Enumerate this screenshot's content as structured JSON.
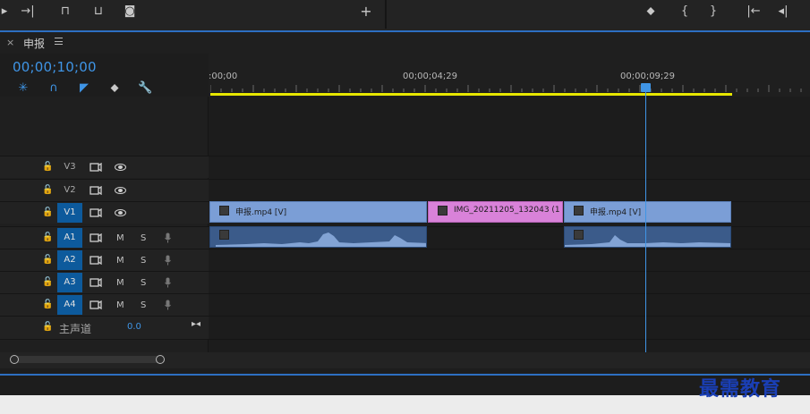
{
  "sequence": {
    "name": "申报",
    "timecode": "00;00;10;00"
  },
  "ruler": {
    "labels": [
      ":00;00",
      "00;00;04;29",
      "00;00;09;29"
    ]
  },
  "master": {
    "label": "主声道",
    "value": "0.0"
  },
  "tracks": {
    "video": [
      {
        "name": "V3",
        "selected": false
      },
      {
        "name": "V2",
        "selected": false
      },
      {
        "name": "V1",
        "selected": true
      }
    ],
    "audio": [
      {
        "name": "A1",
        "m": "M",
        "s": "S"
      },
      {
        "name": "A2",
        "m": "M",
        "s": "S"
      },
      {
        "name": "A3",
        "m": "M",
        "s": "S"
      },
      {
        "name": "A4",
        "m": "M",
        "s": "S"
      }
    ]
  },
  "clips": {
    "v1": [
      "申报.mp4 [V]",
      "IMG_20211205_132043 (1).jp",
      "申报.mp4 [V]"
    ]
  },
  "watermark": "最需教育",
  "colors": {
    "accent": "#3f95e6",
    "video_clip": "#7b9ed6",
    "image_clip": "#d982d9",
    "audio_clip": "#3b5b8a",
    "work_area": "#e6e600"
  }
}
